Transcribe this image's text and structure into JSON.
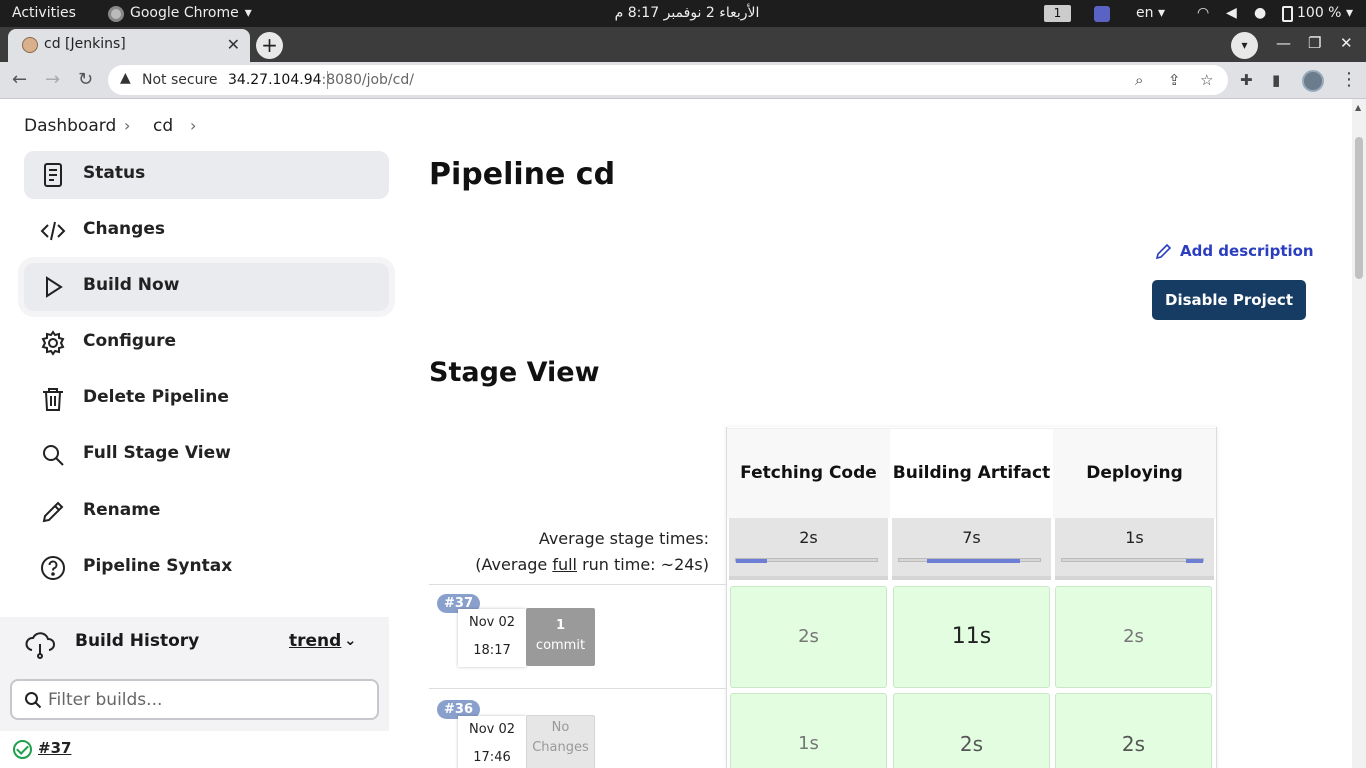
{
  "os": {
    "activities": "Activities",
    "app_name": "Google Chrome",
    "clock": "الأربعاء 2 نوفمبر  8:17 م",
    "workspace": "1",
    "lang": "en",
    "battery": "100 %"
  },
  "browser": {
    "tab_title": "cd [Jenkins]",
    "not_secure": "Not secure",
    "url_host": "34.27.104.94",
    "url_path": ":8080/job/cd/"
  },
  "breadcrumb": [
    "Dashboard",
    "cd"
  ],
  "sidebar": {
    "items": [
      {
        "label": "Status"
      },
      {
        "label": "Changes"
      },
      {
        "label": "Build Now"
      },
      {
        "label": "Configure"
      },
      {
        "label": "Delete Pipeline"
      },
      {
        "label": "Full Stage View"
      },
      {
        "label": "Rename"
      },
      {
        "label": "Pipeline Syntax"
      }
    ]
  },
  "build_history": {
    "title": "Build History",
    "trend": "trend",
    "filter_placeholder": "Filter builds...",
    "first_build": "#37"
  },
  "main": {
    "title": "Pipeline cd",
    "add_description": "Add description",
    "disable_button": "Disable Project",
    "stage_view_title": "Stage View"
  },
  "stage_view": {
    "stages": [
      "Fetching Code",
      "Building Artifact",
      "Deploying"
    ],
    "avg_label_1": "Average stage times:",
    "avg_label_2_pre": "(Average ",
    "avg_label_2_full": "full",
    "avg_label_2_post": " run time: ~24s)",
    "avg_times": [
      "2s",
      "7s",
      "1s"
    ],
    "avg_progress": [
      0.22,
      0.66,
      0.12
    ],
    "runs": [
      {
        "badge": "#37",
        "date": "Nov 02",
        "time": "18:17",
        "changes_count": "1",
        "changes_text": "commit",
        "durations": [
          "2s",
          "11s",
          "2s"
        ]
      },
      {
        "badge": "#36",
        "date": "Nov 02",
        "time": "17:46",
        "changes_count": "No",
        "changes_text": "Changes",
        "durations": [
          "1s",
          "2s",
          "2s"
        ]
      }
    ]
  }
}
